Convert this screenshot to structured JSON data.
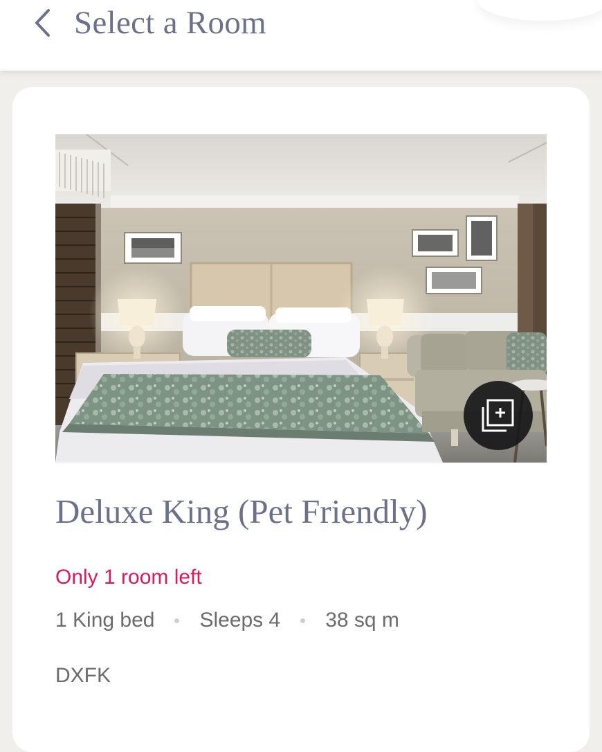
{
  "header": {
    "back_icon": "chevron-left-icon",
    "title": "Select a Room"
  },
  "room": {
    "name": "Deluxe King (Pet Friendly)",
    "availability": "Only 1 room left",
    "bed": "1 King bed",
    "sleeps": "Sleeps 4",
    "size": "38 sq m",
    "code": "DXFK",
    "gallery_icon": "gallery-add-icon"
  },
  "colors": {
    "background": "#f1efeb",
    "title": "#6d7089",
    "availability": "#d81b60",
    "text_secondary": "#6b6b6b",
    "card": "#ffffff"
  }
}
